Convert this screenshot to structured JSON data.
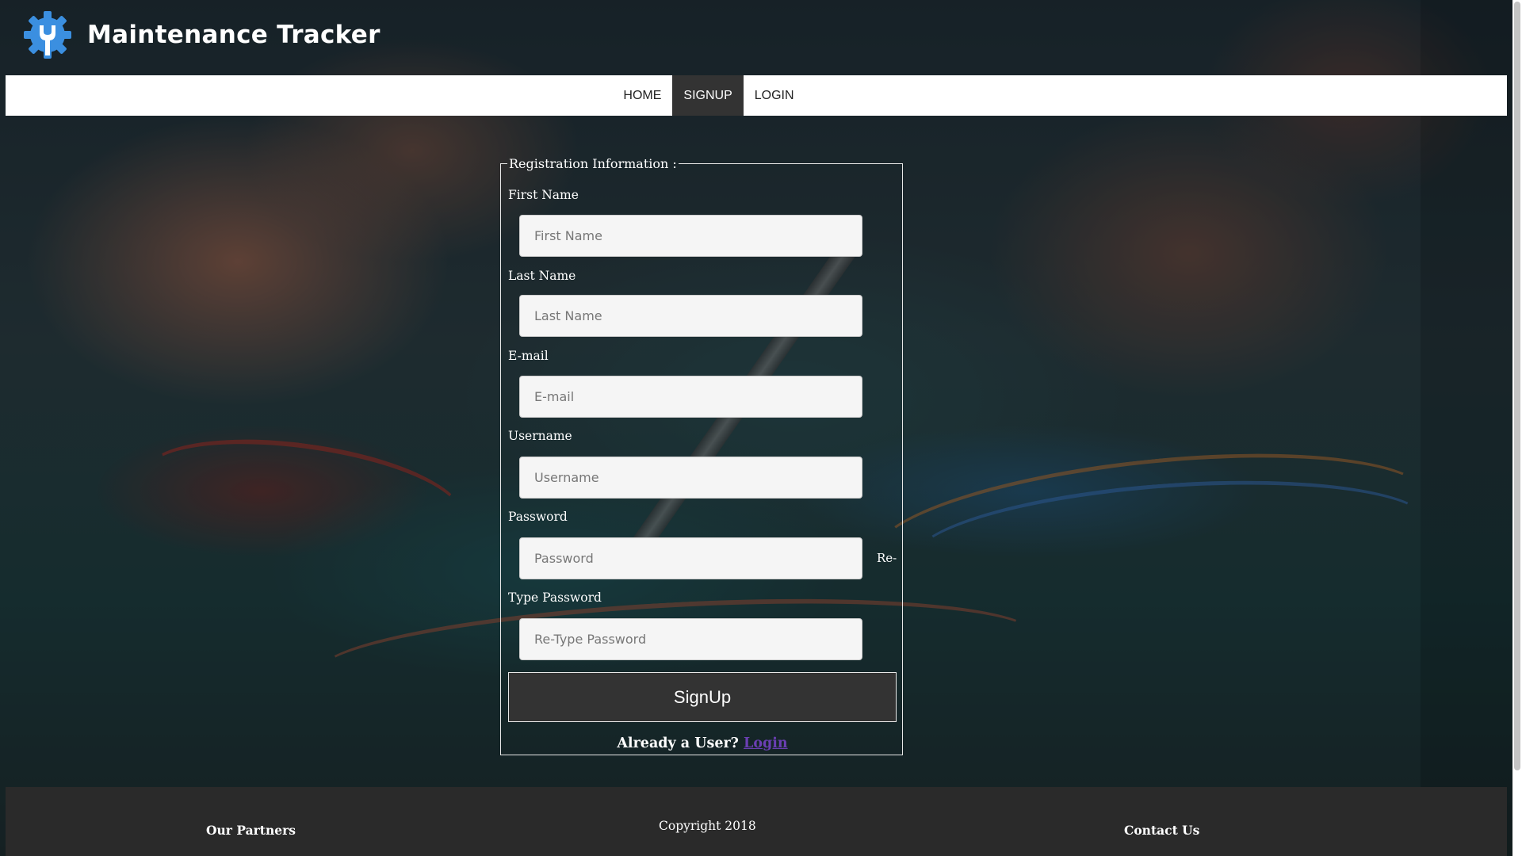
{
  "app": {
    "title": "Maintenance Tracker"
  },
  "nav": {
    "items": [
      {
        "label": "HOME",
        "active": false
      },
      {
        "label": "SIGNUP",
        "active": true
      },
      {
        "label": "LOGIN",
        "active": false
      }
    ]
  },
  "form": {
    "legend": "Registration Information :",
    "fields": [
      {
        "label": "First Name",
        "placeholder": "First Name",
        "value": ""
      },
      {
        "label": "Last Name",
        "placeholder": "Last Name",
        "value": ""
      },
      {
        "label": "E-mail",
        "placeholder": "E-mail",
        "value": ""
      },
      {
        "label": "Username",
        "placeholder": "Username",
        "value": ""
      },
      {
        "label": "Password",
        "placeholder": "Password",
        "value": ""
      },
      {
        "label": "Type Password",
        "placeholder": "Re-Type Password",
        "value": ""
      }
    ],
    "password_suffix": "Re-",
    "submit_label": "SignUp",
    "already_text": "Already a User?",
    "login_link": "Login"
  },
  "footer": {
    "partners": "Our Partners",
    "copyright": "Copyright 2018",
    "contact": "Contact Us"
  },
  "colors": {
    "accent": "#3b8fe0",
    "nav_active_bg": "#333333",
    "footer_bg": "#2a2a2a",
    "link": "#6b3fb4"
  },
  "icons": {
    "logo": "gear-wrench-icon"
  }
}
